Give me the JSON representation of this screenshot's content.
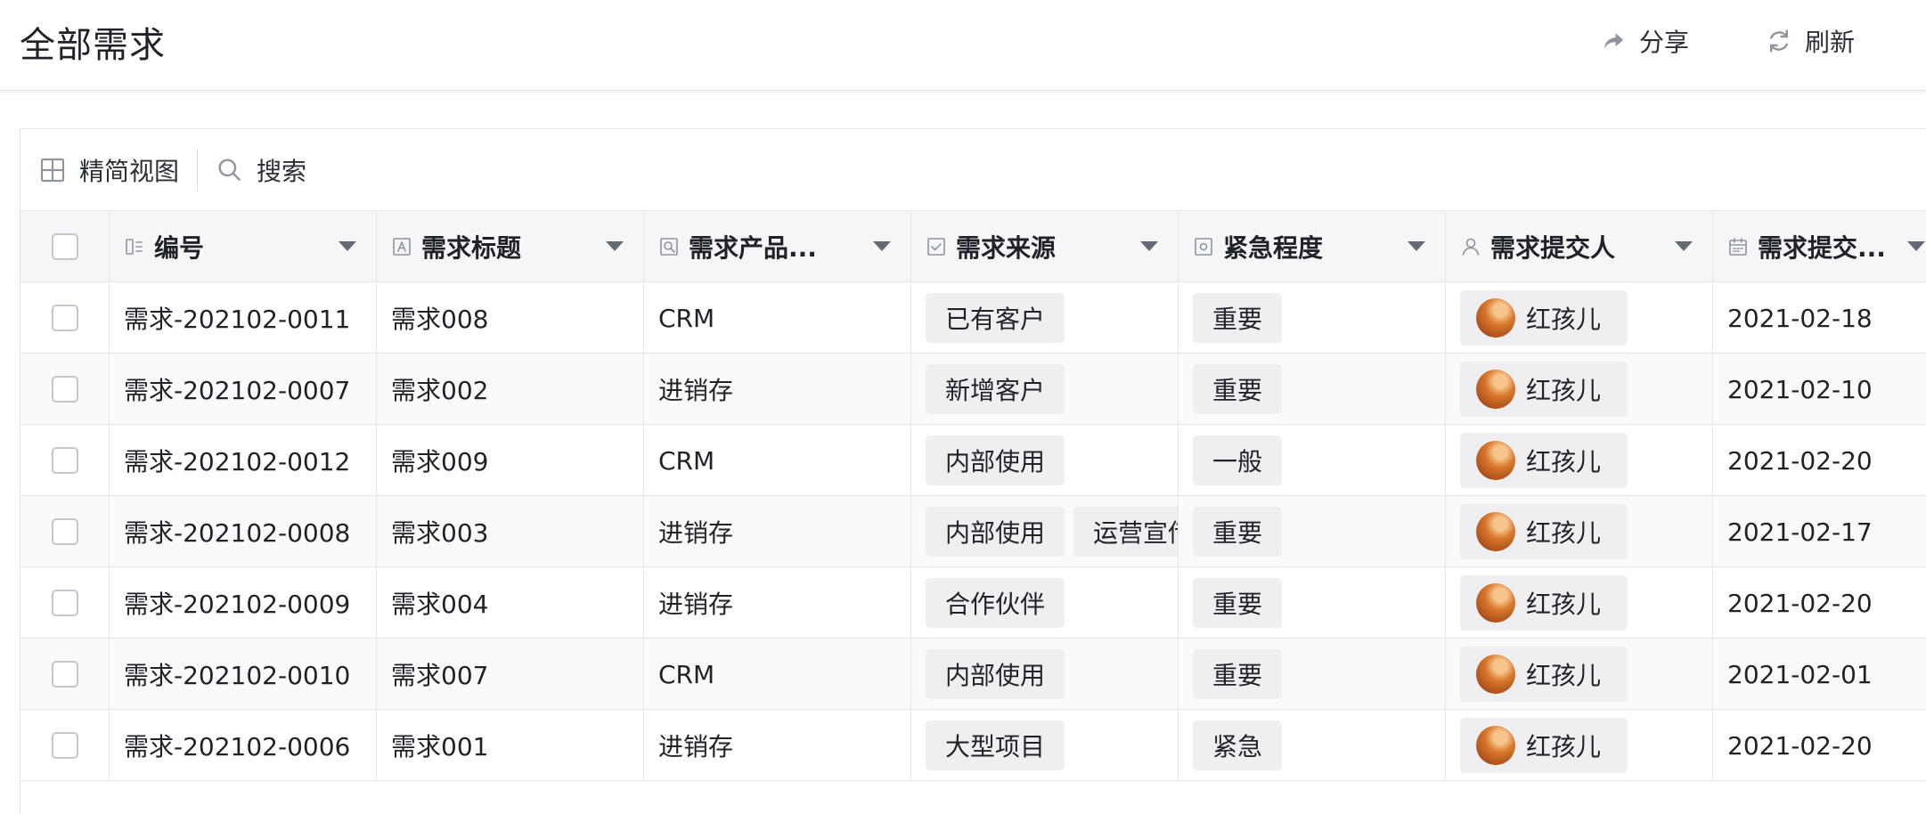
{
  "header": {
    "title": "全部需求",
    "share_label": "分享",
    "refresh_label": "刷新"
  },
  "toolbar": {
    "view_label": "精简视图",
    "search_label": "搜索"
  },
  "table": {
    "columns": [
      {
        "label": "编号",
        "icon": "autonumber-icon"
      },
      {
        "label": "需求标题",
        "icon": "text-field-icon"
      },
      {
        "label": "需求产品...",
        "icon": "lookup-icon"
      },
      {
        "label": "需求来源",
        "icon": "checkbox-field-icon"
      },
      {
        "label": "紧急程度",
        "icon": "single-select-icon"
      },
      {
        "label": "需求提交人",
        "icon": "person-icon"
      },
      {
        "label": "需求提交...",
        "icon": "calendar-icon"
      }
    ],
    "rows": [
      {
        "id": "需求-202102-0011",
        "title": "需求008",
        "product": "CRM",
        "sources": [
          "已有客户"
        ],
        "urgency": "重要",
        "submitter": "红孩儿",
        "date": "2021-02-18"
      },
      {
        "id": "需求-202102-0007",
        "title": "需求002",
        "product": "进销存",
        "sources": [
          "新增客户"
        ],
        "urgency": "重要",
        "submitter": "红孩儿",
        "date": "2021-02-10"
      },
      {
        "id": "需求-202102-0012",
        "title": "需求009",
        "product": "CRM",
        "sources": [
          "内部使用"
        ],
        "urgency": "一般",
        "submitter": "红孩儿",
        "date": "2021-02-20"
      },
      {
        "id": "需求-202102-0008",
        "title": "需求003",
        "product": "进销存",
        "sources": [
          "内部使用",
          "运营宣传"
        ],
        "urgency": "重要",
        "submitter": "红孩儿",
        "date": "2021-02-17"
      },
      {
        "id": "需求-202102-0009",
        "title": "需求004",
        "product": "进销存",
        "sources": [
          "合作伙伴"
        ],
        "urgency": "重要",
        "submitter": "红孩儿",
        "date": "2021-02-20"
      },
      {
        "id": "需求-202102-0010",
        "title": "需求007",
        "product": "CRM",
        "sources": [
          "内部使用"
        ],
        "urgency": "重要",
        "submitter": "红孩儿",
        "date": "2021-02-01"
      },
      {
        "id": "需求-202102-0006",
        "title": "需求001",
        "product": "进销存",
        "sources": [
          "大型项目"
        ],
        "urgency": "紧急",
        "submitter": "红孩儿",
        "date": "2021-02-20"
      }
    ]
  }
}
